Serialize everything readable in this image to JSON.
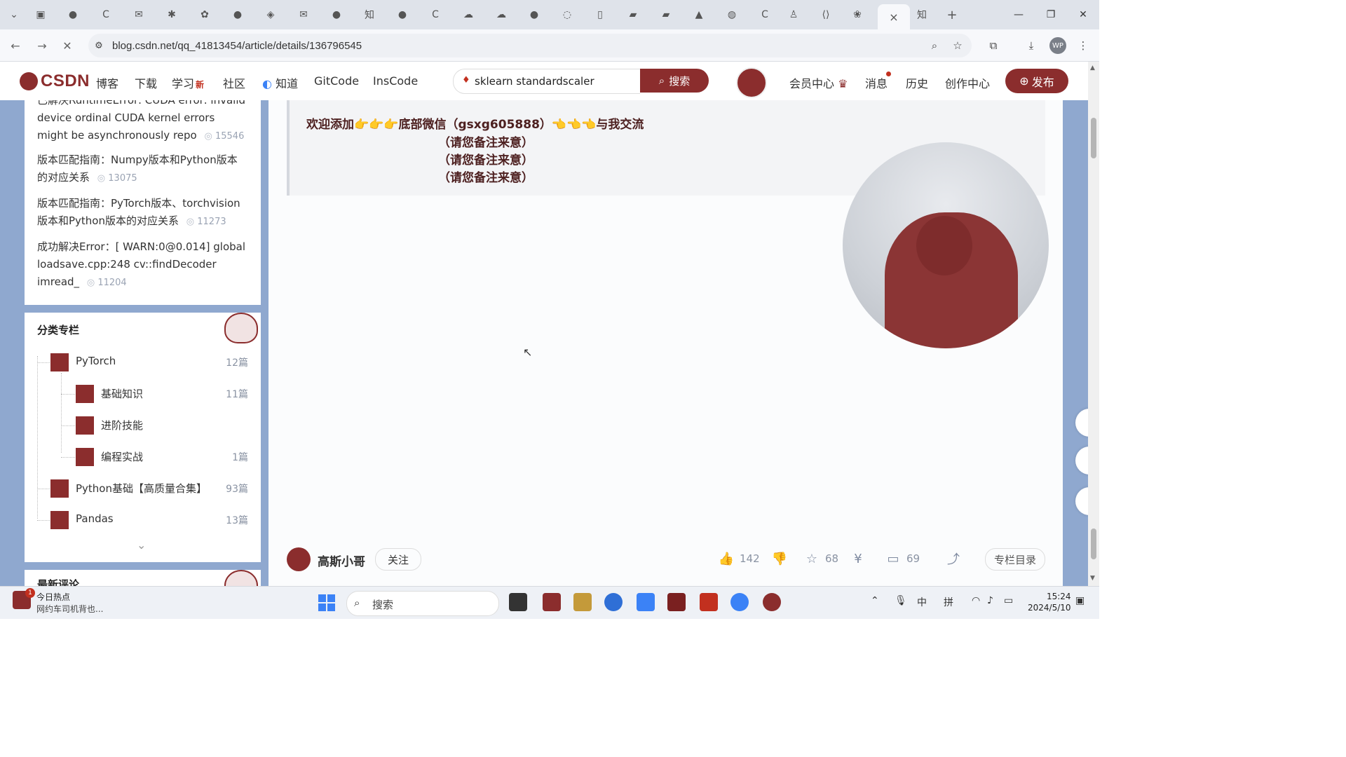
{
  "browser": {
    "tab_icons": [
      "chevron-down-icon",
      "calendar-icon",
      "github-icon",
      "csdn-icon",
      "mail-icon",
      "ai-icon",
      "bot-icon",
      "github-icon",
      "cube-icon",
      "mail-icon",
      "github-icon",
      "zhihu-icon",
      "github-icon",
      "csdn-icon",
      "cloud-icon",
      "cloud-icon",
      "github-icon",
      "loading-icon",
      "doc-icon",
      "book-icon",
      "book-icon",
      "cap-icon",
      "globe-icon",
      "csdn-icon",
      "person-icon",
      "bracket-icon",
      "paw-icon"
    ],
    "active_tab_close": "×",
    "new_tab": "+",
    "url": "blog.csdn.net/qq_41813454/article/details/136796545",
    "profile_initials": "WP"
  },
  "csdn_nav": {
    "logo": "CSDN",
    "items": [
      "博客",
      "下载",
      "学习",
      "社区",
      "知道",
      "GitCode",
      "InsCode"
    ],
    "learn_badge": "新",
    "search_query": "sklearn standardscaler",
    "search_button": "搜索",
    "right_items": [
      "会员中心",
      "消息",
      "历史",
      "创作中心"
    ],
    "publish": "发布"
  },
  "sidebar": {
    "hot_articles": [
      {
        "title": "已解决RuntimeError: CUDA error: invalid device ordinal CUDA kernel errors might be asynchronously repo",
        "views": "15546"
      },
      {
        "title": "版本匹配指南：Numpy版本和Python版本的对应关系",
        "views": "13075"
      },
      {
        "title": "版本匹配指南：PyTorch版本、torchvision版本和Python版本的对应关系",
        "views": "11273"
      },
      {
        "title": "成功解决Error：[ WARN:0@0.014] global loadsave.cpp:248 cv::findDecoder imread_",
        "views": "11204"
      }
    ],
    "category_title": "分类专栏",
    "categories": [
      {
        "name": "PyTorch",
        "count": "12篇"
      },
      {
        "name": "基础知识",
        "count": "11篇"
      },
      {
        "name": "进阶技能",
        "count": ""
      },
      {
        "name": "编程实战",
        "count": "1篇"
      },
      {
        "name": "Python基础【高质量合集】",
        "count": "93篇"
      },
      {
        "name": "Pandas",
        "count": "13篇"
      }
    ],
    "expand": "⌄",
    "latest_comments_title": "最新评论"
  },
  "article": {
    "welcome_line": "欢迎添加👉👉👉底部微信（gsxg605888）👈👈👈与我交流",
    "notes": [
      "（请您备注来意）",
      "（请您备注来意）",
      "（请您备注来意）"
    ]
  },
  "toolbar": {
    "author": "高斯小哥",
    "follow": "关注",
    "likes": "142",
    "favorites": "68",
    "comments": "69",
    "catalog": "专栏目录"
  },
  "taskbar": {
    "news_badge": "1",
    "news_title": "今日热点",
    "news_sub": "网约车司机背也...",
    "search": "搜索",
    "ime1": "中",
    "ime2": "拼",
    "time": "15:24",
    "date": "2024/5/10"
  },
  "colors": {
    "brand": "#8b2d2d",
    "page_bg": "#8fa8cf"
  }
}
